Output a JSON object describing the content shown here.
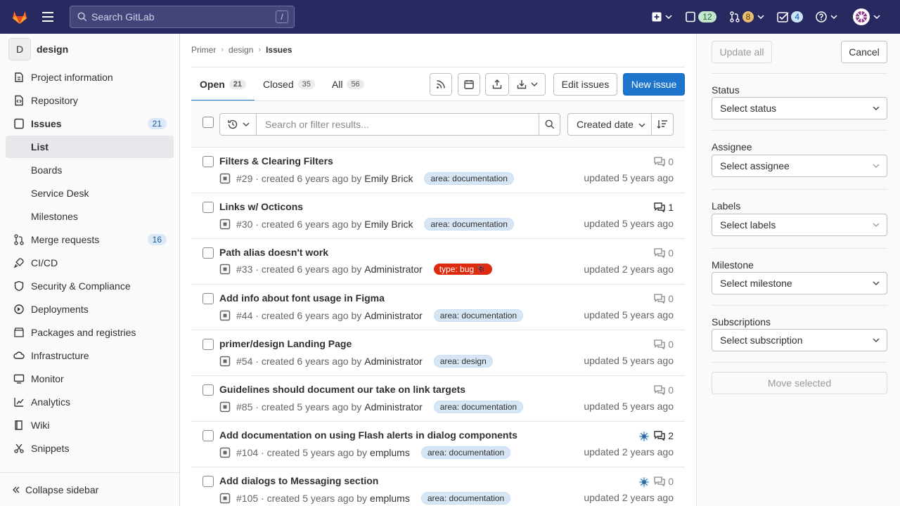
{
  "topbar": {
    "search_placeholder": "Search GitLab",
    "search_shortcut": "/",
    "issues_count": "12",
    "merge_requests_count": "8",
    "todos_count": "4"
  },
  "sidebar": {
    "project_initial": "D",
    "project_name": "design",
    "items": [
      {
        "label": "Project information"
      },
      {
        "label": "Repository"
      },
      {
        "label": "Issues",
        "count": "21"
      },
      {
        "label": "List"
      },
      {
        "label": "Boards"
      },
      {
        "label": "Service Desk"
      },
      {
        "label": "Milestones"
      },
      {
        "label": "Merge requests",
        "count": "16"
      },
      {
        "label": "CI/CD"
      },
      {
        "label": "Security & Compliance"
      },
      {
        "label": "Deployments"
      },
      {
        "label": "Packages and registries"
      },
      {
        "label": "Infrastructure"
      },
      {
        "label": "Monitor"
      },
      {
        "label": "Analytics"
      },
      {
        "label": "Wiki"
      },
      {
        "label": "Snippets"
      }
    ],
    "collapse_label": "Collapse sidebar"
  },
  "breadcrumb": [
    "Primer",
    "design",
    "Issues"
  ],
  "tabs": [
    {
      "label": "Open",
      "count": "21"
    },
    {
      "label": "Closed",
      "count": "35"
    },
    {
      "label": "All",
      "count": "56"
    }
  ],
  "toolbar": {
    "edit_issues": "Edit issues",
    "new_issue": "New issue"
  },
  "filter": {
    "placeholder": "Search or filter results...",
    "sort_label": "Created date"
  },
  "issues": [
    {
      "title": "Filters & Clearing Filters",
      "ref": "#29",
      "created": "created 6 years ago by",
      "author": "Emily Brick",
      "label": "area: documentation",
      "comments": "0",
      "updated": "updated 5 years ago"
    },
    {
      "title": "Links w/ Octicons",
      "ref": "#30",
      "created": "created 6 years ago by",
      "author": "Emily Brick",
      "label": "area: documentation",
      "comments": "1",
      "updated": "updated 5 years ago"
    },
    {
      "title": "Path alias doesn't work",
      "ref": "#33",
      "created": "created 6 years ago by",
      "author": "Administrator",
      "label": "type: bug",
      "comments": "0",
      "updated": "updated 2 years ago"
    },
    {
      "title": "Add info about font usage in Figma",
      "ref": "#44",
      "created": "created 6 years ago by",
      "author": "Administrator",
      "label": "area: documentation",
      "comments": "0",
      "updated": "updated 5 years ago"
    },
    {
      "title": "primer/design Landing Page",
      "ref": "#54",
      "created": "created 6 years ago by",
      "author": "Administrator",
      "label": "area: design",
      "comments": "0",
      "updated": "updated 5 years ago"
    },
    {
      "title": "Guidelines should document our take on link targets",
      "ref": "#85",
      "created": "created 5 years ago by",
      "author": "Administrator",
      "label": "area: documentation",
      "comments": "0",
      "updated": "updated 5 years ago"
    },
    {
      "title": "Add documentation on using Flash alerts in dialog components",
      "ref": "#104",
      "created": "created 5 years ago by",
      "author": "emplums",
      "label": "area: documentation",
      "comments": "2",
      "updated": "updated 2 years ago"
    },
    {
      "title": "Add dialogs to Messaging section",
      "ref": "#105",
      "created": "created 5 years ago by",
      "author": "emplums",
      "label": "area: documentation",
      "comments": "0",
      "updated": "updated 2 years ago"
    }
  ],
  "bulk": {
    "update_all": "Update all",
    "cancel": "Cancel",
    "status_label": "Status",
    "status_placeholder": "Select status",
    "assignee_label": "Assignee",
    "assignee_placeholder": "Select assignee",
    "labels_label": "Labels",
    "labels_placeholder": "Select labels",
    "milestone_label": "Milestone",
    "milestone_placeholder": "Select milestone",
    "subscriptions_label": "Subscriptions",
    "subscriptions_placeholder": "Select subscription",
    "move_selected": "Move selected"
  },
  "colors": {
    "navbar": "#292961",
    "primary": "#1f75cb",
    "bug_label": "#dd2b0e",
    "doc_label": "#d6e6f5"
  }
}
